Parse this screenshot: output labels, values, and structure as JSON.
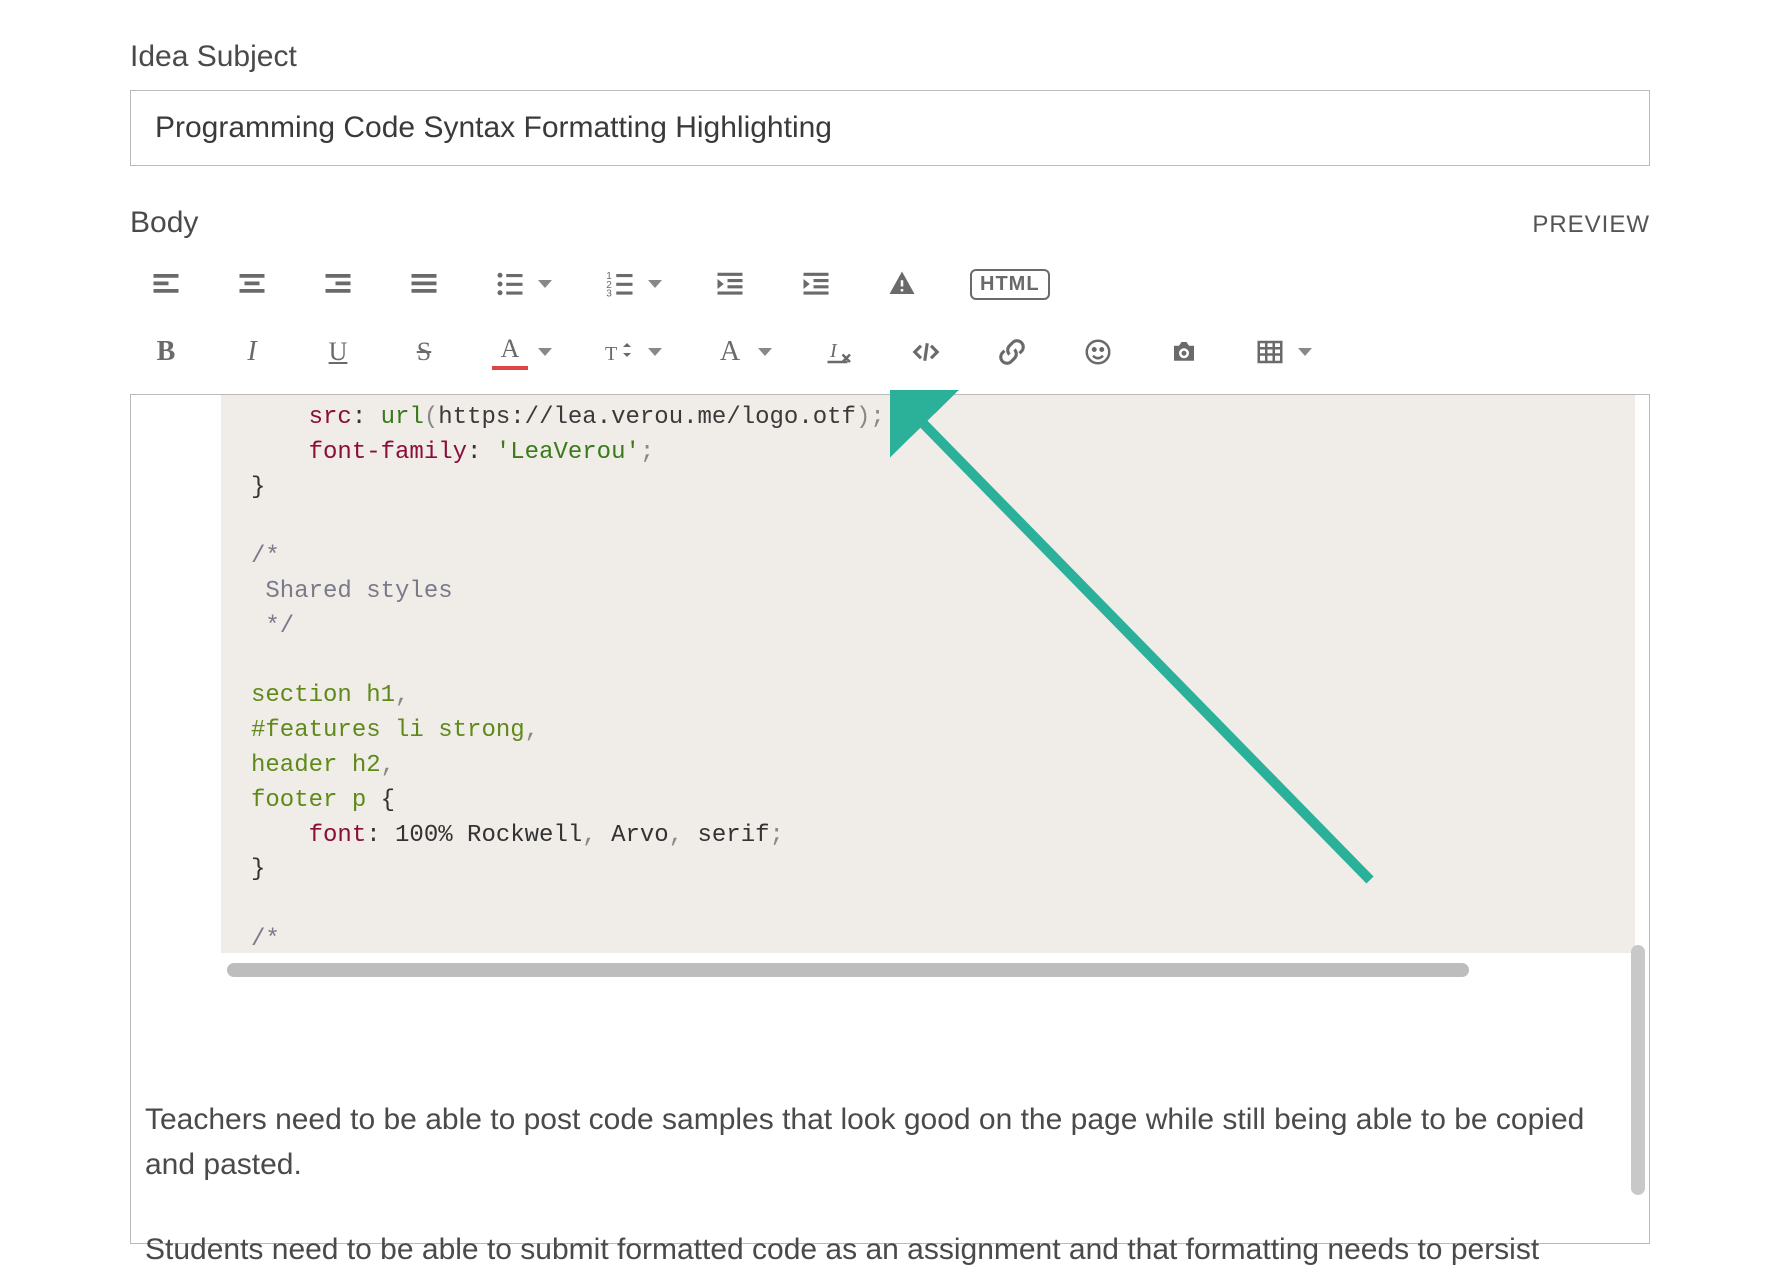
{
  "labels": {
    "subject": "Idea Subject",
    "body": "Body",
    "preview": "PREVIEW"
  },
  "subject_value": "Programming Code Syntax Formatting Highlighting",
  "toolbar": {
    "row1": [
      "align-left",
      "align-center",
      "align-right",
      "align-justify",
      "bullet-list",
      "bullet-dropdown",
      "numbered-list",
      "numbered-dropdown",
      "outdent",
      "indent",
      "spoiler",
      "html-source"
    ],
    "row2": [
      "bold",
      "italic",
      "underline",
      "strikethrough",
      "text-color",
      "text-color-dropdown",
      "font-size",
      "font-family",
      "clear-formatting",
      "insert-code",
      "insert-link",
      "emoji",
      "insert-image",
      "insert-table",
      "table-dropdown"
    ],
    "html_label": "HTML"
  },
  "code": {
    "l1_a": "src",
    "l1_b": ": ",
    "l1_c": "url",
    "l1_d": "(",
    "l1_e": "https://lea.verou.me/logo.otf",
    "l1_f": ");",
    "l2_a": "font-family",
    "l2_b": ": ",
    "l2_c": "'LeaVerou'",
    "l2_d": ";",
    "l3": "}",
    "l4": "",
    "l5": "/*",
    "l6": " Shared styles",
    "l7": " */",
    "l8": "",
    "l9_a": "section h1",
    "l9_b": ",",
    "l10_a": "#features li strong",
    "l10_b": ",",
    "l11_a": "header h2",
    "l11_b": ",",
    "l12_a": "footer p",
    "l12_b": " {",
    "l13_a": "font",
    "l13_b": ": ",
    "l13_c": "100%",
    "l13_d": " Rockwell",
    "l13_e": ",",
    "l13_f": " Arvo",
    "l13_g": ",",
    "l13_h": " serif",
    "l13_i": ";",
    "l14": "}",
    "l15": "",
    "l16": "/*"
  },
  "body_paragraphs": {
    "p1": "Teachers need to be able to post code samples that look good on the page while still being able to be copied and pasted.",
    "p2": "Students need to be able to submit formatted code as an assignment and that formatting needs to persist"
  },
  "annotation": {
    "color": "#2bb09a"
  }
}
